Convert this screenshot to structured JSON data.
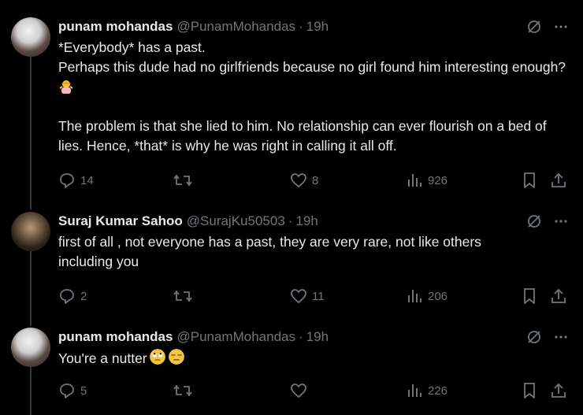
{
  "tweets": [
    {
      "name": "punam mohandas",
      "handle": "@PunamMohandas",
      "dot": "·",
      "time": "19h",
      "lines": [
        "*Everybody* has a past.",
        "Perhaps this dude had no girlfriends because no girl found him interesting enough?",
        "",
        "The problem is that she lied to him. No relationship can ever flourish on a bed of lies. Hence, *that* is why he was right in calling it all off."
      ],
      "replies": "14",
      "retweets": "",
      "likes": "8",
      "views": "926"
    },
    {
      "name": "Suraj Kumar Sahoo",
      "handle": "@SurajKu50503",
      "dot": "·",
      "time": "19h",
      "lines": [
        "first of all , not everyone has a past, they are very rare, not like others including you"
      ],
      "replies": "2",
      "retweets": "",
      "likes": "11",
      "views": "206"
    },
    {
      "name": "punam mohandas",
      "handle": "@PunamMohandas",
      "dot": "·",
      "time": "19h",
      "lines": [
        "You're a nutter"
      ],
      "replies": "5",
      "retweets": "",
      "likes": "",
      "views": "226"
    }
  ],
  "icons": {
    "reply": "reply-icon",
    "retweet": "retweet-icon",
    "like": "heart-icon",
    "views": "views-icon",
    "bookmark": "bookmark-icon",
    "share": "share-icon",
    "grok": "grok-icon",
    "more": "more-icon"
  },
  "colors": {
    "background": "#000000",
    "text": "#e7e9ea",
    "muted": "#71767b",
    "line": "#333639"
  }
}
